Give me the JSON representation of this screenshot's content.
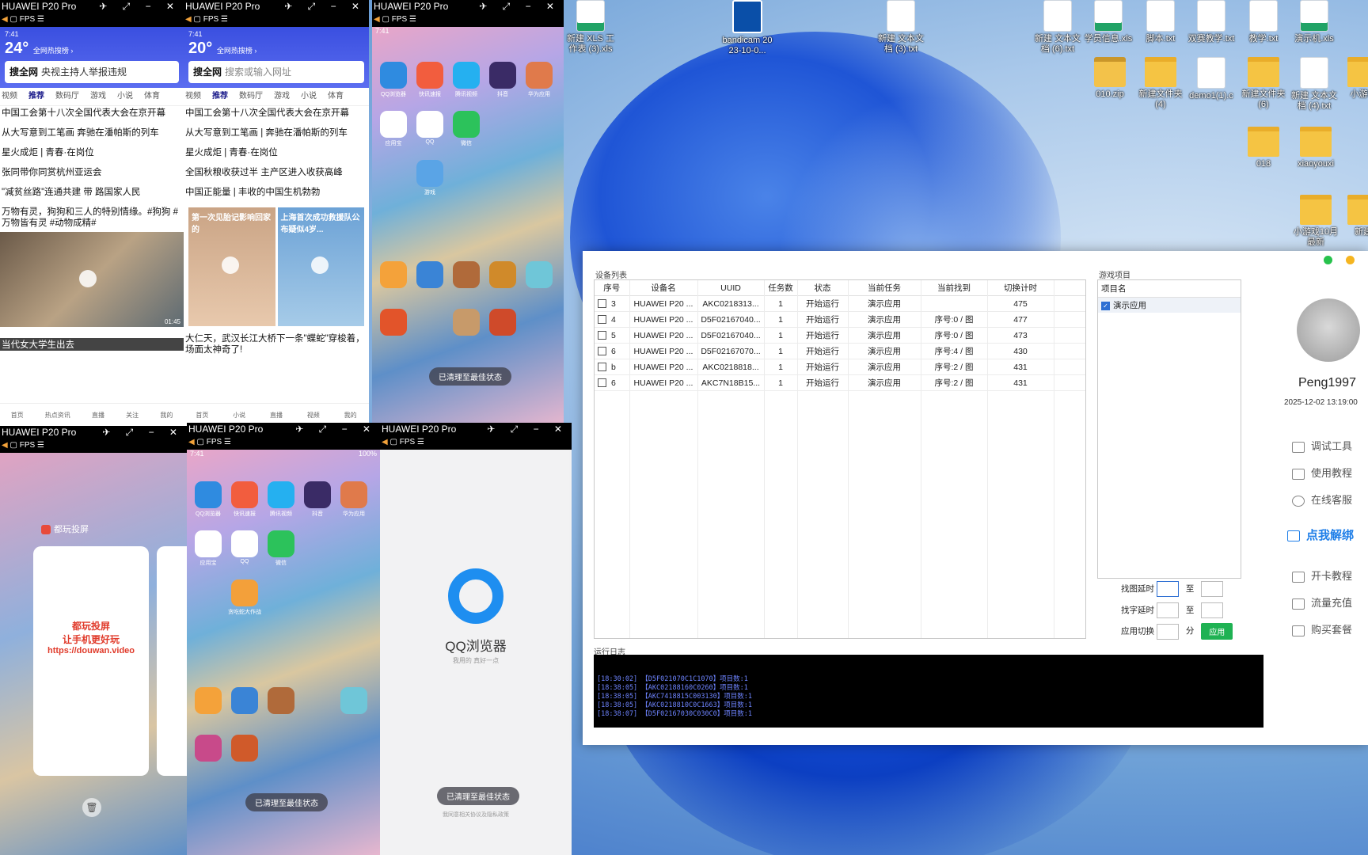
{
  "desktop": {
    "icons": [
      {
        "label": "新建 XLS 工作表 (3).xls",
        "type": "xls"
      },
      {
        "label": "bandicam 2023-10-0...",
        "type": "video"
      },
      {
        "label": "新建 文本文档 (3).txt",
        "type": "doc"
      },
      {
        "label": "新建 文本文档 (6).txt",
        "type": "doc"
      },
      {
        "label": "学员信息.xls",
        "type": "xls"
      },
      {
        "label": "脚本.txt",
        "type": "doc"
      },
      {
        "label": "双赛教学.txt",
        "type": "doc"
      },
      {
        "label": "教学.txt",
        "type": "doc"
      },
      {
        "label": "演示机.xls",
        "type": "xls"
      },
      {
        "label": "010.zip",
        "type": "zip"
      },
      {
        "label": "新建文件夹 (4)",
        "type": "folder"
      },
      {
        "label": "demo1(1).c",
        "type": "doc"
      },
      {
        "label": "新建文件夹 (6)",
        "type": "folder"
      },
      {
        "label": "新建 文本文档 (4).txt",
        "type": "doc"
      },
      {
        "label": "小游戏",
        "type": "folder"
      },
      {
        "label": "018",
        "type": "folder"
      },
      {
        "label": "xiaoyouxi",
        "type": "folder"
      },
      {
        "label": "小游戏10月最新",
        "type": "folder"
      },
      {
        "label": "新建",
        "type": "folder"
      }
    ]
  },
  "phones": [
    {
      "title": "HUAWEI P20 Pro",
      "toolbar": "FPS",
      "status_time": "7:41",
      "weather_temp": "24°",
      "weather_note": "全网热搜榜 ›",
      "search_brand": "搜全网",
      "search_text": "央视主持人举报违规",
      "tabs": [
        "视频",
        "推荐",
        "数码厅",
        "游戏",
        "小说",
        "体育"
      ],
      "news": [
        "中国工会第十八次全国代表大会在京开幕",
        "从大写意到工笔画 奔驰在潘帕斯的列车",
        "星火成炬 | 青春·在岗位",
        "张同带你同赏杭州亚运会",
        "\"减贫丝路\"连通共建 带 路国家人民",
        "万物有灵，狗狗和三人的特别情缘。#狗狗 #万物皆有灵 #动物成精#"
      ],
      "video_time": "01:45",
      "bottom_caption": "当代女大学生出去",
      "nav": [
        "首页",
        "热点资讯",
        "直播",
        "关注",
        "我的"
      ]
    },
    {
      "title": "HUAWEI P20 Pro",
      "toolbar": "FPS",
      "status_time": "7:41",
      "weather_temp": "20°",
      "weather_note": "全网热搜榜 ›",
      "search_brand": "搜全网",
      "search_text": "搜索或输入网址",
      "tabs": [
        "视频",
        "推荐",
        "数码厅",
        "游戏",
        "小说",
        "体育"
      ],
      "news": [
        "中国工会第十八次全国代表大会在京开幕",
        "从大写意到工笔画 | 奔驰在潘帕斯的列车",
        "星火成炬 | 青春·在岗位",
        "全国秋粮收获过半 主产区进入收获高峰",
        "中国正能量 | 丰收的中国生机勃勃"
      ],
      "card1": "第一次见胎记影响回家的",
      "card2": "上海首次成功救援队公布疑似4岁...",
      "bottom_news": "大仁天，武汉长江大桥下一条\"蝶蛇\"穿梭着，场面太神奇了!",
      "nav": [
        "首页",
        "小说",
        "直播",
        "视频",
        "我的"
      ]
    },
    {
      "title": "HUAWEI P20 Pro",
      "toolbar": "FPS",
      "status_time": "7:41",
      "apps": [
        "QQ浏览器",
        "快讯速报",
        "腾讯视频",
        "抖音",
        "华为应用",
        "应用宝",
        "QQ",
        "微信",
        "游戏"
      ],
      "pill": "已清理至最佳状态"
    },
    {
      "title": "HUAWEI P20 Pro",
      "toolbar": "FPS",
      "recent_app": "都玩投屏",
      "recent_text1": "都玩投屏",
      "recent_text2": "让手机更好玩",
      "recent_text3": "https://douwan.video"
    },
    {
      "title": "HUAWEI P20 Pro",
      "toolbar": "FPS",
      "status_time": "7:41",
      "battery": "100%",
      "apps": [
        "QQ浏览器",
        "快讯速报",
        "腾讯视频",
        "抖音",
        "华为应用",
        "应用宝",
        "QQ",
        "微信",
        "贪吃蛇大作战"
      ],
      "pill": "已清理至最佳状态"
    },
    {
      "title": "HUAWEI P20 Pro",
      "toolbar": "FPS",
      "brand": "QQ浏览器",
      "slogan": "我用的 真好一点",
      "pill": "已清理至最佳状态",
      "footer": "我同意相关协议及隐私政策"
    }
  ],
  "controller": {
    "device_list_title": "设备列表",
    "project_title": "游戏项目",
    "columns": [
      "序号",
      "设备名",
      "UUID",
      "任务数",
      "状态",
      "当前任务",
      "当前找到",
      "切换计时"
    ],
    "rows": [
      {
        "index": "3",
        "name": "HUAWEI P20 ...",
        "uuid": "AKC0218313...",
        "tasks": "1",
        "status": "开始运行",
        "task": "演示应用",
        "found": "",
        "timer": "475"
      },
      {
        "index": "4",
        "name": "HUAWEI P20 ...",
        "uuid": "D5F02167040...",
        "tasks": "1",
        "status": "开始运行",
        "task": "演示应用",
        "found": "序号:0 / 图",
        "timer": "477"
      },
      {
        "index": "5",
        "name": "HUAWEI P20 ...",
        "uuid": "D5F02167040...",
        "tasks": "1",
        "status": "开始运行",
        "task": "演示应用",
        "found": "序号:0 / 图",
        "timer": "473"
      },
      {
        "index": "6",
        "name": "HUAWEI P20 ...",
        "uuid": "D5F02167070...",
        "tasks": "1",
        "status": "开始运行",
        "task": "演示应用",
        "found": "序号:4 / 图",
        "timer": "430"
      },
      {
        "index": "b",
        "name": "HUAWEI P20 ...",
        "uuid": "AKC0218818...",
        "tasks": "1",
        "status": "开始运行",
        "task": "演示应用",
        "found": "序号:2 / 图",
        "timer": "431"
      },
      {
        "index": "6",
        "name": "HUAWEI P20 ...",
        "uuid": "AKC7N18B15...",
        "tasks": "1",
        "status": "开始运行",
        "task": "演示应用",
        "found": "序号:2 / 图",
        "timer": "431"
      }
    ],
    "project_header": "项目名",
    "project_item": "演示应用",
    "find_delay_label": "找图延时",
    "to_label": "至",
    "click_delay_label": "找字延时",
    "to_label2": "至",
    "switch_label": "应用切换",
    "minute_label": "分",
    "apply_label": "应用",
    "log_title": "运行日志",
    "log_lines": [
      "[18:30:02] 【D5F021070C1C1070】项目数:1",
      "[18:38:05] 【AKC02188160C0260】项目数:1",
      "[18:38:05] 【AKC7418815C003130】项目数:1",
      "[18:38:05] 【AKC0218810C0C1663】项目数:1",
      "[18:38:07] 【D5F02167030C030C0】项目数:1"
    ],
    "user_name": "Peng1997",
    "user_date": "2025-12-02 13:19:00",
    "menu": [
      "调试工具",
      "使用教程",
      "在线客服",
      "点我解绑",
      "开卡教程",
      "流量充值",
      "购买套餐"
    ]
  }
}
